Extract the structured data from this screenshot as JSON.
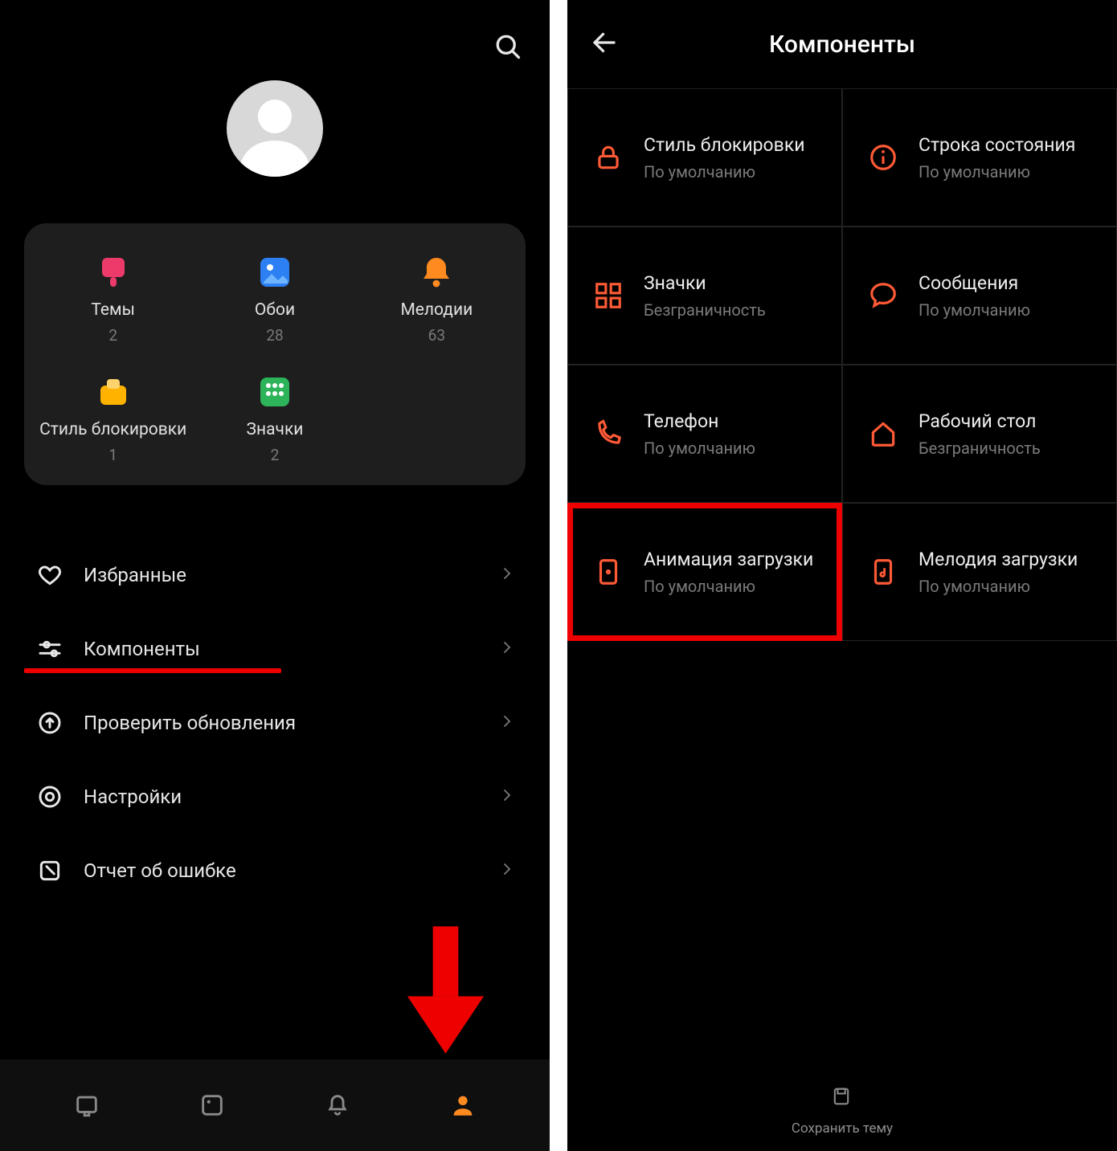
{
  "left": {
    "tiles": [
      {
        "label": "Темы",
        "count": "2",
        "icon": "theme-icon",
        "color": "#ec3b6a"
      },
      {
        "label": "Обои",
        "count": "28",
        "icon": "wallpaper-icon",
        "color": "#2d7ff4"
      },
      {
        "label": "Мелодии",
        "count": "63",
        "icon": "ringtone-icon",
        "color": "#ff8a1f"
      },
      {
        "label": "Стиль блокировки",
        "count": "1",
        "icon": "lock-style-icon",
        "color": "#ffb300"
      },
      {
        "label": "Значки",
        "count": "2",
        "icon": "icons-icon",
        "color": "#2db35a"
      }
    ],
    "menu": [
      {
        "label": "Избранные",
        "icon": "heart-icon"
      },
      {
        "label": "Компоненты",
        "icon": "sliders-icon"
      },
      {
        "label": "Проверить обновления",
        "icon": "update-icon"
      },
      {
        "label": "Настройки",
        "icon": "gear-icon"
      },
      {
        "label": "Отчет об ошибке",
        "icon": "report-icon"
      }
    ],
    "nav": [
      {
        "name": "nav-home-icon",
        "active": false
      },
      {
        "name": "nav-wallpaper-icon",
        "active": false
      },
      {
        "name": "nav-bell-icon",
        "active": false
      },
      {
        "name": "nav-profile-icon",
        "active": true
      }
    ]
  },
  "right": {
    "title": "Компоненты",
    "save": "Сохранить тему",
    "components": [
      {
        "title": "Стиль блокировки",
        "value": "По умолчанию",
        "icon": "lock-icon"
      },
      {
        "title": "Строка состояния",
        "value": "По умолчанию",
        "icon": "info-icon"
      },
      {
        "title": "Значки",
        "value": "Безграничность",
        "icon": "grid-icon"
      },
      {
        "title": "Сообщения",
        "value": "По умолчанию",
        "icon": "chat-icon"
      },
      {
        "title": "Телефон",
        "value": "По умолчанию",
        "icon": "phone-icon"
      },
      {
        "title": "Рабочий стол",
        "value": "Безграничность",
        "icon": "home-icon"
      },
      {
        "title": "Анимация загрузки",
        "value": "По умолчанию",
        "icon": "boot-anim-icon"
      },
      {
        "title": "Мелодия загрузки",
        "value": "По умолчанию",
        "icon": "boot-sound-icon"
      }
    ]
  },
  "accent": "#ff5a36"
}
